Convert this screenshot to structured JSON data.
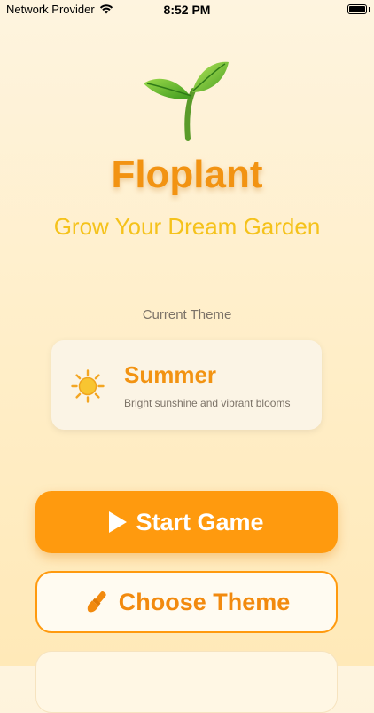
{
  "status_bar": {
    "carrier": "Network Provider",
    "time": "8:52 PM",
    "icons": [
      "wifi-icon",
      "battery-icon"
    ]
  },
  "app": {
    "logo_icon": "sprout-icon",
    "title": "Floplant",
    "tagline": "Grow Your Dream Garden"
  },
  "theme_section": {
    "heading": "Current Theme",
    "current": {
      "icon": "sun-icon",
      "name": "Summer",
      "description": "Bright sunshine and vibrant blooms"
    }
  },
  "actions": {
    "start_label": "Start Game",
    "start_icon": "play-icon",
    "choose_theme_label": "Choose Theme",
    "choose_theme_icon": "paintbrush-icon"
  },
  "colors": {
    "accent": "#FF9A0E",
    "title": "#F29312",
    "tagline": "#F5C21B",
    "muted_text": "#7C7368"
  }
}
